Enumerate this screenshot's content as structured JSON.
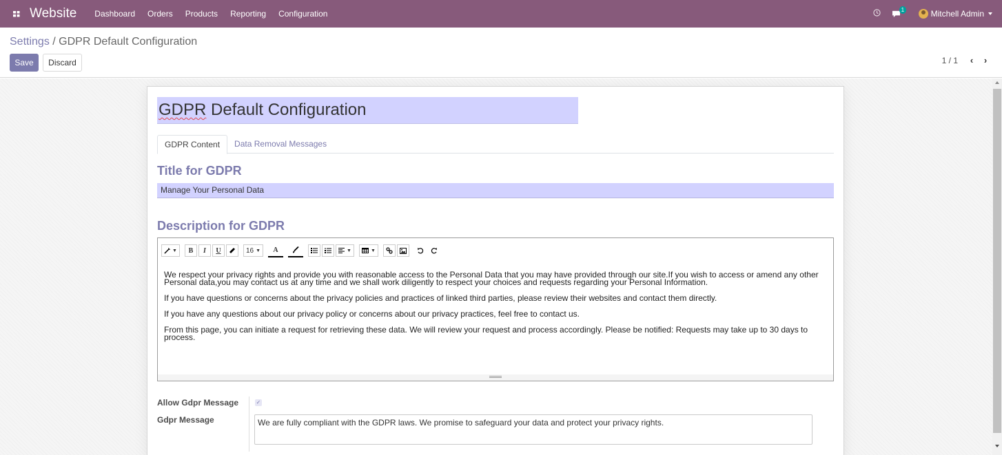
{
  "navbar": {
    "app_name": "Website",
    "menu": [
      "Dashboard",
      "Orders",
      "Products",
      "Reporting",
      "Configuration"
    ],
    "chat_count": "1",
    "user_name": "Mitchell Admin",
    "color": "#875a7b"
  },
  "control_panel": {
    "breadcrumb_parent": "Settings",
    "breadcrumb_separator": "/",
    "breadcrumb_current": "GDPR Default Configuration",
    "save_label": "Save",
    "discard_label": "Discard",
    "pager_value": "1 / 1"
  },
  "form": {
    "name_misspelled": "GDPR",
    "name_rest": " Default Configuration",
    "tabs": [
      "GDPR Content",
      "Data Removal Messages"
    ],
    "title_heading": "Title for GDPR",
    "title_value": "Manage Your Personal Data",
    "description_heading": "Description for GDPR",
    "toolbar": {
      "font_size": "16",
      "bold": "B",
      "italic": "I",
      "underline": "U",
      "text_color": "A"
    },
    "description_paragraphs": [
      "We respect your privacy rights and provide you with reasonable access to the Personal Data that you may have provided through our site.If you wish to access or amend any other Personal data,you may contact us at any time and we shall work diligently to respect your choices and requests regarding your Personal Information.",
      "If you have questions or concerns about the privacy policies and practices of linked third parties, please review their websites and contact them directly.",
      "If you have any questions about our privacy policy or concerns about our privacy practices, feel free to contact us.",
      "From this page, you can initiate a request for retrieving these data. We will review your request and process accordingly. Please be notified: Requests may take up to 30 days to process."
    ],
    "allow_message_label": "Allow Gdpr Message",
    "allow_message_checked": true,
    "message_label": "Gdpr Message",
    "message_value": "We are fully compliant with the GDPR laws. We promise to safeguard your data and protect your privacy rights.",
    "accent_color": "#7c7bad",
    "input_color": "#d2d2ff"
  }
}
